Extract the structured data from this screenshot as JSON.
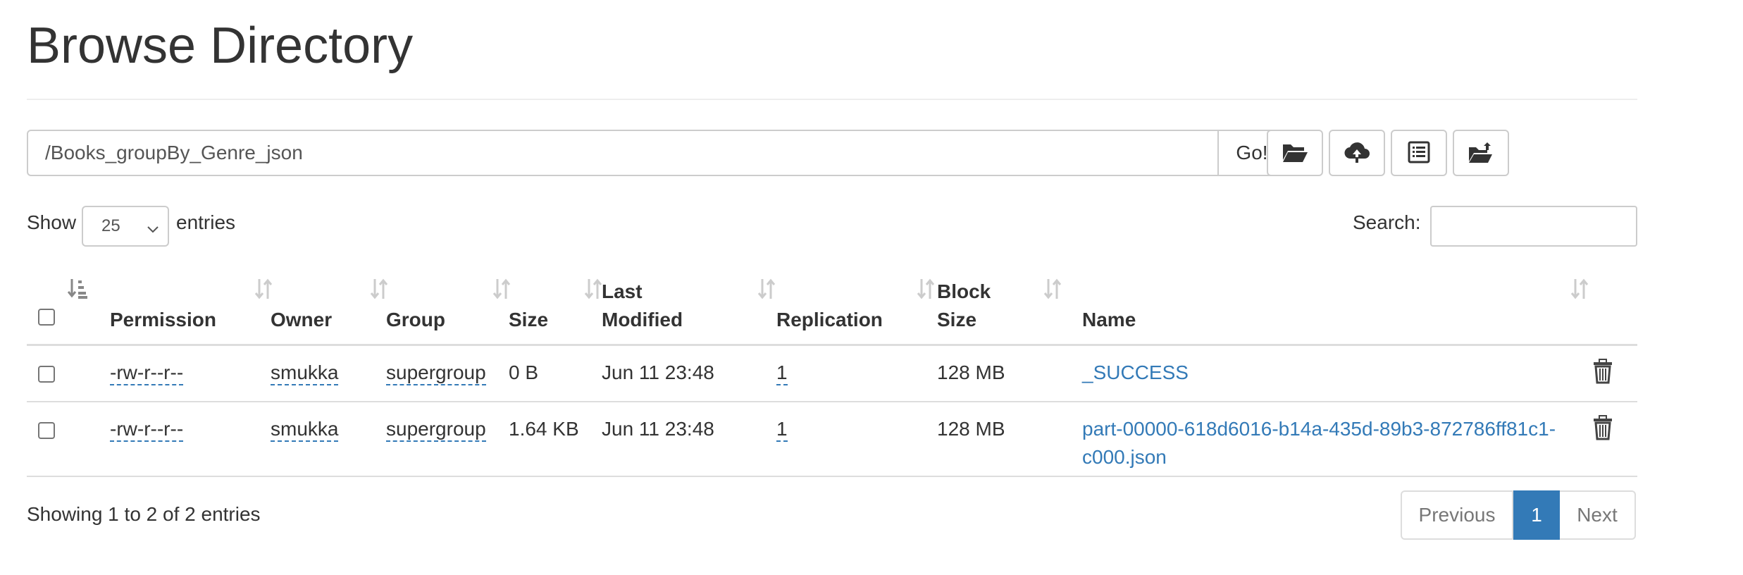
{
  "page": {
    "title": "Browse Directory"
  },
  "pathbar": {
    "value": "/Books_groupBy_Genre_json",
    "go_label": "Go!"
  },
  "toolbar": {
    "buttons": [
      {
        "icon": "folder-open-icon",
        "tooltip": ""
      },
      {
        "icon": "cloud-upload-icon",
        "tooltip": ""
      },
      {
        "icon": "list-alt-icon",
        "tooltip": ""
      },
      {
        "icon": "folder-move-icon",
        "tooltip": ""
      }
    ]
  },
  "length": {
    "prefix": "Show",
    "value": "25",
    "suffix": "entries"
  },
  "search": {
    "label": "Search:",
    "value": ""
  },
  "table": {
    "columns": {
      "permission": "Permission",
      "owner": "Owner",
      "group": "Group",
      "size": "Size",
      "modified_1": "Last",
      "modified_2": "Modified",
      "replication": "Replication",
      "block_1": "Block",
      "block_2": "Size",
      "name": "Name"
    },
    "rows": [
      {
        "permission": "-rw-r--r--",
        "owner": "smukka",
        "group": "supergroup",
        "size": "0 B",
        "modified": "Jun 11 23:48",
        "replication": "1",
        "block_size": "128 MB",
        "name_1": "_SUCCESS",
        "name_2": ""
      },
      {
        "permission": "-rw-r--r--",
        "owner": "smukka",
        "group": "supergroup",
        "size": "1.64 KB",
        "modified": "Jun 11 23:48",
        "replication": "1",
        "block_size": "128 MB",
        "name_1": "part-00000-618d6016-b14a-435d-89b3-872786ff81c1-",
        "name_2": "c000.json"
      }
    ]
  },
  "footer": {
    "info": "Showing 1 to 2 of 2 entries",
    "pagination": {
      "previous": "Previous",
      "current": "1",
      "next": "Next"
    }
  },
  "colors": {
    "link": "#337ab7",
    "border": "#cccccc",
    "text": "#333333"
  }
}
